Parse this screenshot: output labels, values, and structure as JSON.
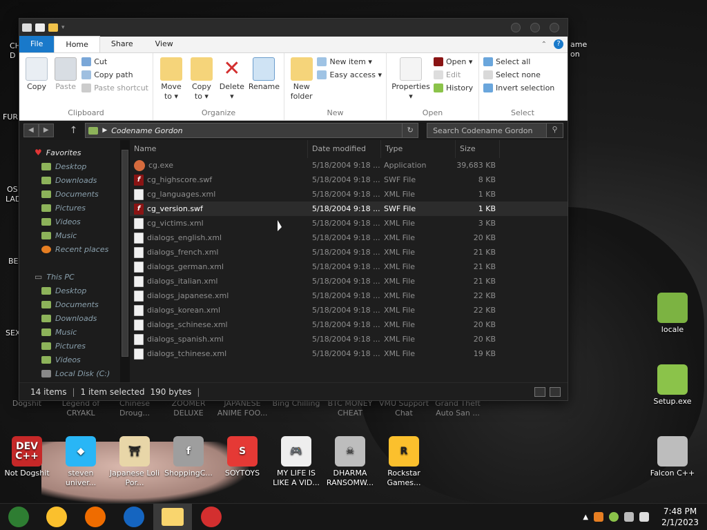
{
  "desktop": {
    "left_edge_labels": [
      "CH",
      "D",
      "FUR",
      "OS",
      "LAD",
      "BE",
      "SEX"
    ],
    "right_partial": [
      "ame",
      "on"
    ],
    "top_row": [
      {
        "label": "Dogshit",
        "color": "#c9a53a"
      },
      {
        "label": "Legend of CRYAKL",
        "color": "#333"
      },
      {
        "label": "Chinese Droug...",
        "color": "#333"
      },
      {
        "label": "ZOOMER DELUXE",
        "color": "#333"
      },
      {
        "label": "JAPANESE ANIME FOO...",
        "color": "#333"
      },
      {
        "label": "Bing Chilling",
        "color": "#333"
      },
      {
        "label": "BTC MONEY CHEAT",
        "color": "#333"
      },
      {
        "label": "VMU Support Chat",
        "color": "#333"
      },
      {
        "label": "Grand Theft Auto San ...",
        "color": "#333"
      }
    ],
    "bottom_row": [
      {
        "label": "Not Dogshit",
        "color": "#c62828",
        "glyph": "DEV C++"
      },
      {
        "label": "steven univer...",
        "color": "#29b6f6",
        "glyph": "◆"
      },
      {
        "label": "Japanese Loli Por...",
        "color": "#e8d6a8",
        "glyph": "⛩"
      },
      {
        "label": "ShoppingC...",
        "color": "#9e9e9e",
        "glyph": "f"
      },
      {
        "label": "SOYTOYS",
        "color": "#e53935",
        "glyph": "S"
      },
      {
        "label": "MY LIFE IS LIKE A VID...",
        "color": "#eeeeee",
        "glyph": "🎮"
      },
      {
        "label": "DHARMA RANSOMW...",
        "color": "#bdbdbd",
        "glyph": "☠"
      },
      {
        "label": "Rockstar Games...",
        "color": "#fbc02d",
        "glyph": "R"
      }
    ],
    "right_icons": [
      {
        "label": "locale",
        "color": "#7cb342"
      },
      {
        "label": "Setup.exe",
        "color": "#8bc34a"
      },
      {
        "label": "Falcon C++",
        "color": "#bdbdbd"
      }
    ]
  },
  "explorer": {
    "tabs": {
      "file": "File",
      "home": "Home",
      "share": "Share",
      "view": "View"
    },
    "ribbon": {
      "clipboard": {
        "label": "Clipboard",
        "copy": "Copy",
        "paste": "Paste",
        "cut": "Cut",
        "copy_path": "Copy path",
        "paste_shortcut": "Paste shortcut"
      },
      "organize": {
        "label": "Organize",
        "move_to": "Move to ▾",
        "copy_to": "Copy to ▾",
        "delete": "Delete ▾",
        "rename": "Rename"
      },
      "new": {
        "label": "New",
        "new_folder": "New folder",
        "new_item": "New item ▾",
        "easy_access": "Easy access ▾"
      },
      "open": {
        "label": "Open",
        "properties": "Properties ▾",
        "open": "Open ▾",
        "edit": "Edit",
        "history": "History"
      },
      "select": {
        "label": "Select",
        "select_all": "Select all",
        "select_none": "Select none",
        "invert": "Invert selection"
      }
    },
    "address": {
      "path": "Codename Gordon",
      "search_placeholder": "Search Codename Gordon"
    },
    "nav": {
      "favorites": "Favorites",
      "favorites_items": [
        "Desktop",
        "Downloads",
        "Documents",
        "Pictures",
        "Videos",
        "Music",
        "Recent places"
      ],
      "this_pc": "This PC",
      "pc_items": [
        "Desktop",
        "Documents",
        "Downloads",
        "Music",
        "Pictures",
        "Videos",
        "Local Disk (C:)"
      ]
    },
    "columns": {
      "name": "Name",
      "date": "Date modified",
      "type": "Type",
      "size": "Size"
    },
    "files": [
      {
        "name": "cg.exe",
        "date": "5/18/2004 9:18 ...",
        "type": "Application",
        "size": "39,683 KB",
        "icon": "exe"
      },
      {
        "name": "cg_highscore.swf",
        "date": "5/18/2004 9:18 ...",
        "type": "SWF File",
        "size": "8 KB",
        "icon": "swf"
      },
      {
        "name": "cg_languages.xml",
        "date": "5/18/2004 9:18 ...",
        "type": "XML File",
        "size": "1 KB",
        "icon": "xml"
      },
      {
        "name": "cg_version.swf",
        "date": "5/18/2004 9:18 ...",
        "type": "SWF File",
        "size": "1 KB",
        "icon": "swf",
        "selected": true
      },
      {
        "name": "cg_victims.xml",
        "date": "5/18/2004 9:18 ...",
        "type": "XML File",
        "size": "3 KB",
        "icon": "xml"
      },
      {
        "name": "dialogs_english.xml",
        "date": "5/18/2004 9:18 ...",
        "type": "XML File",
        "size": "20 KB",
        "icon": "xml"
      },
      {
        "name": "dialogs_french.xml",
        "date": "5/18/2004 9:18 ...",
        "type": "XML File",
        "size": "21 KB",
        "icon": "xml"
      },
      {
        "name": "dialogs_german.xml",
        "date": "5/18/2004 9:18 ...",
        "type": "XML File",
        "size": "21 KB",
        "icon": "xml"
      },
      {
        "name": "dialogs_italian.xml",
        "date": "5/18/2004 9:18 ...",
        "type": "XML File",
        "size": "21 KB",
        "icon": "xml"
      },
      {
        "name": "dialogs_japanese.xml",
        "date": "5/18/2004 9:18 ...",
        "type": "XML File",
        "size": "22 KB",
        "icon": "xml"
      },
      {
        "name": "dialogs_korean.xml",
        "date": "5/18/2004 9:18 ...",
        "type": "XML File",
        "size": "22 KB",
        "icon": "xml"
      },
      {
        "name": "dialogs_schinese.xml",
        "date": "5/18/2004 9:18 ...",
        "type": "XML File",
        "size": "20 KB",
        "icon": "xml"
      },
      {
        "name": "dialogs_spanish.xml",
        "date": "5/18/2004 9:18 ...",
        "type": "XML File",
        "size": "20 KB",
        "icon": "xml"
      },
      {
        "name": "dialogs_tchinese.xml",
        "date": "5/18/2004 9:18 ...",
        "type": "XML File",
        "size": "19 KB",
        "icon": "xml"
      }
    ],
    "status": {
      "count": "14 items",
      "selected": "1 item selected",
      "bytes": "190 bytes"
    }
  },
  "taskbar": {
    "apps": [
      {
        "name": "chrome-window-icon",
        "color": "#2e7d32"
      },
      {
        "name": "chrome-icon",
        "color": "#fbc02d"
      },
      {
        "name": "firefox-icon",
        "color": "#ef6c00"
      },
      {
        "name": "obama-icon",
        "color": "#1565c0"
      },
      {
        "name": "explorer-icon",
        "color": "#f9d56e",
        "active": true
      },
      {
        "name": "opera-icon",
        "color": "#d32f2f"
      }
    ],
    "time": "7:48 PM",
    "date": "2/1/2023"
  }
}
